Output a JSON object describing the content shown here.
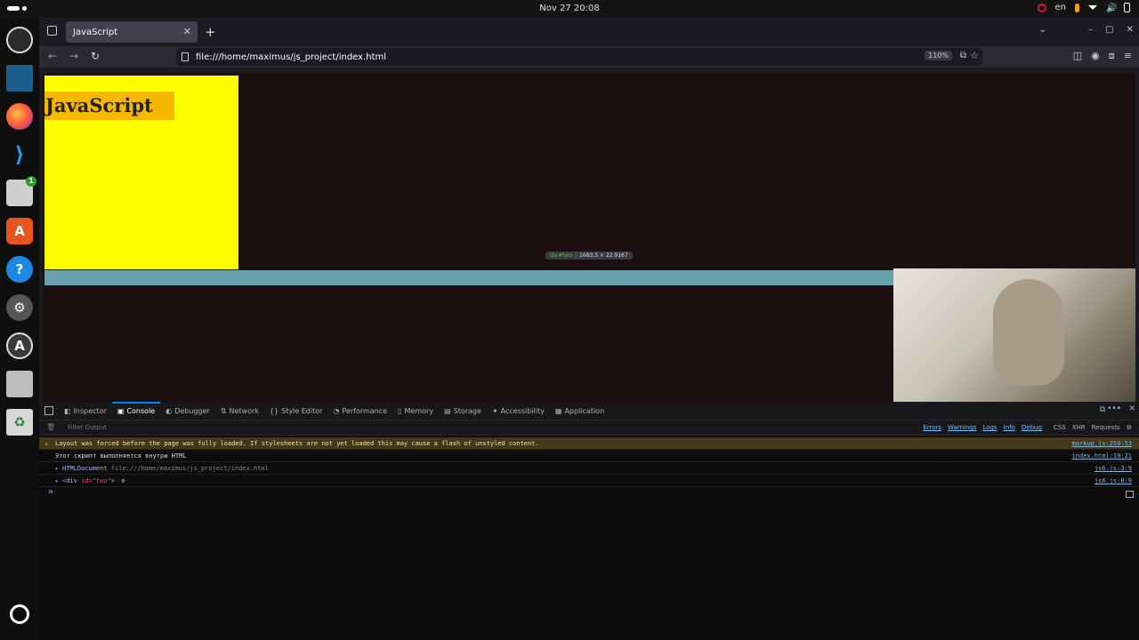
{
  "system": {
    "clock": "Nov 27  20:08",
    "language": "en"
  },
  "dock": {
    "apps": [
      "obs-studio",
      "jetbrains-ide",
      "firefox",
      "vscode",
      "files",
      "app-center",
      "help",
      "settings",
      "software-updater",
      "ssd-disk",
      "trash",
      "ubuntu-apps"
    ]
  },
  "browser": {
    "tab_title": "JavaScript",
    "url": "file:///home/maximus/js_project/index.html",
    "zoom": "110%"
  },
  "page": {
    "heading": "JavaScript",
    "tooltip_selector": "div#two",
    "tooltip_size": "1683.5 × 22.9167"
  },
  "devtools": {
    "tabs": [
      {
        "label": "Inspector",
        "icon": "inspector-icon"
      },
      {
        "label": "Console",
        "icon": "console-icon",
        "active": true
      },
      {
        "label": "Debugger",
        "icon": "debugger-icon"
      },
      {
        "label": "Network",
        "icon": "network-icon"
      },
      {
        "label": "Style Editor",
        "icon": "style-editor-icon"
      },
      {
        "label": "Performance",
        "icon": "performance-icon"
      },
      {
        "label": "Memory",
        "icon": "memory-icon"
      },
      {
        "label": "Storage",
        "icon": "storage-icon"
      },
      {
        "label": "Accessibility",
        "icon": "accessibility-icon"
      },
      {
        "label": "Application",
        "icon": "application-icon"
      }
    ],
    "filter_placeholder": "Filter Output",
    "levels": [
      "Errors",
      "Warnings",
      "Logs",
      "Info",
      "Debug"
    ],
    "net_filters": [
      "CSS",
      "XHR",
      "Requests"
    ],
    "messages": [
      {
        "type": "warn",
        "text": "Layout was forced before the page was fully loaded. If stylesheets are not yet loaded this may cause a flash of unstyled content.",
        "source": "markup.js:250:53"
      },
      {
        "type": "log",
        "text": "Этот скрипт выполняется внутри HTML",
        "source": "index.html:19:21"
      },
      {
        "type": "log",
        "object": "HTMLDocument",
        "url": "file:///home/maximus/js_project/index.html",
        "source": "js6.js:3:9"
      },
      {
        "type": "log",
        "tag_open": "<div ",
        "attr": "id=\"two\"",
        "tag_close": ">",
        "source": "js6.js:8:9"
      }
    ],
    "prompt": "»"
  }
}
